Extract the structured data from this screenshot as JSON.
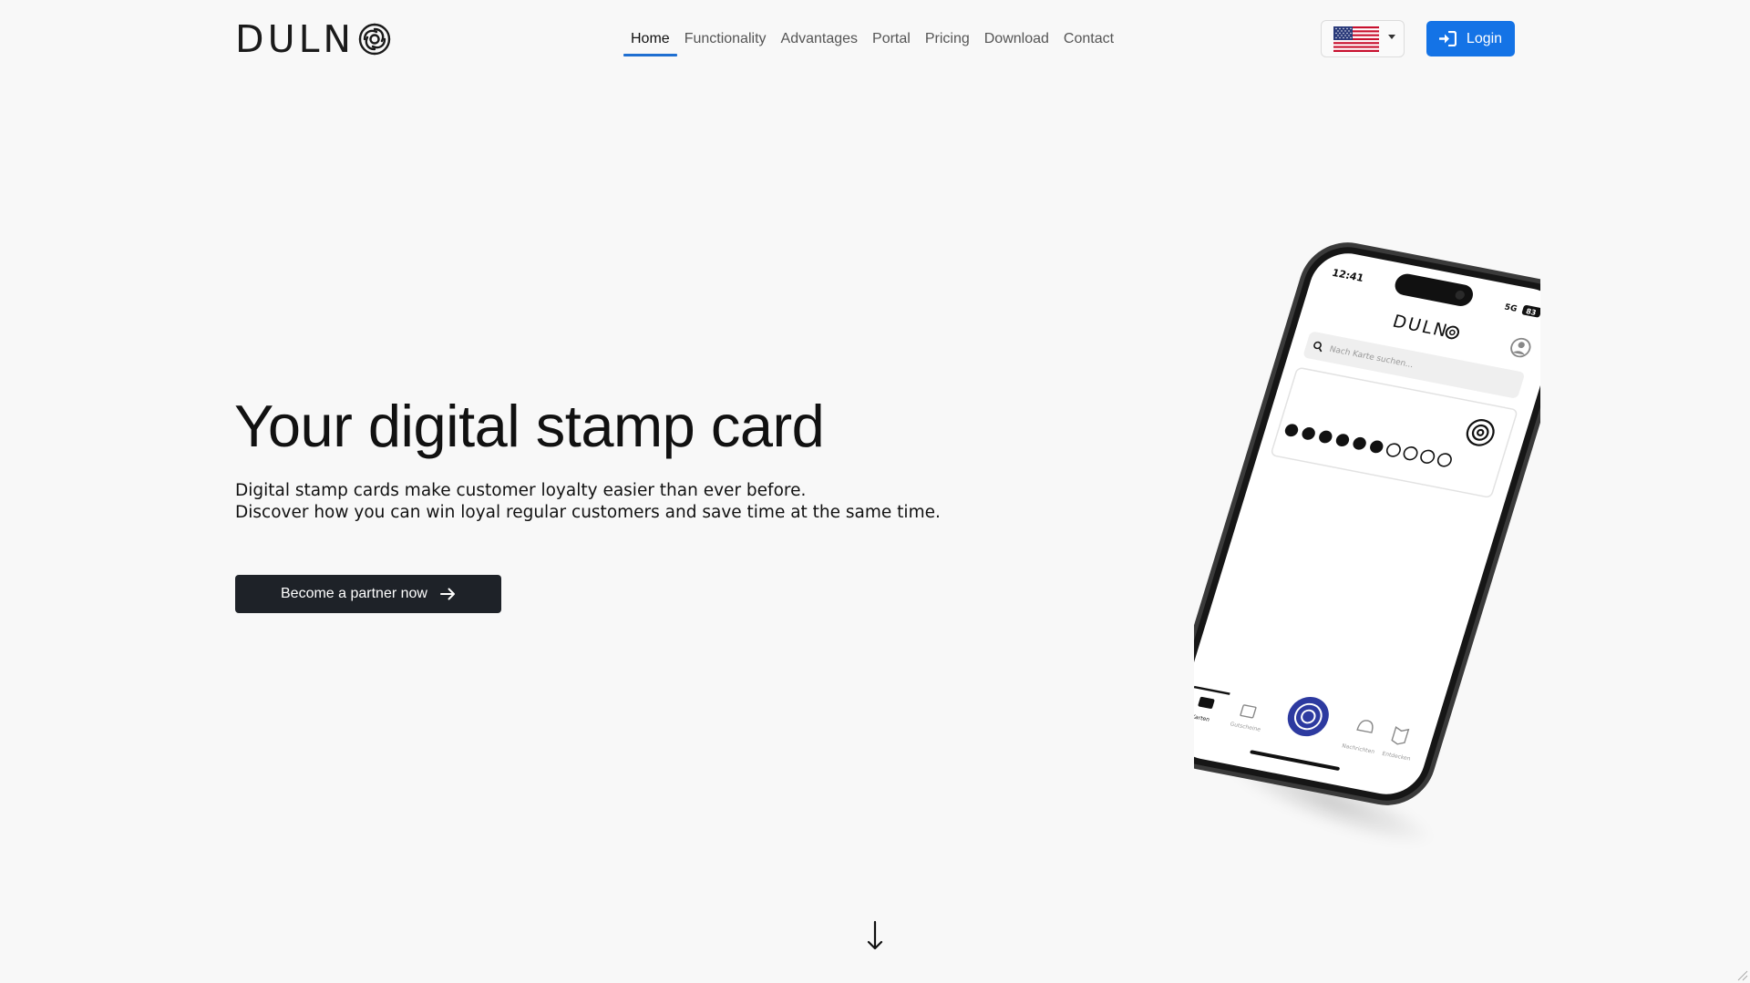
{
  "header": {
    "logo_text": "DULN",
    "nav": [
      {
        "label": "Home",
        "active": true
      },
      {
        "label": "Functionality"
      },
      {
        "label": "Advantages"
      },
      {
        "label": "Portal"
      },
      {
        "label": "Pricing"
      },
      {
        "label": "Download"
      },
      {
        "label": "Contact"
      }
    ],
    "language_icon": "us-flag-icon",
    "login_label": "Login",
    "accent_color": "#1473e6"
  },
  "hero": {
    "title": "Your digital stamp card",
    "subtitle_line1": "Digital stamp cards make customer loyalty easier than ever before.",
    "subtitle_line2": "Discover how you can win loyal regular customers and save time at the same time.",
    "cta_label": "Become a partner now"
  },
  "phone": {
    "time": "12:41",
    "network": "5G",
    "battery": "83",
    "app_logo": "DULN",
    "search_placeholder": "Nach Karte suchen...",
    "stamps_filled": 6,
    "stamps_total": 10,
    "tabs": [
      "Karten",
      "Gutscheine",
      "Nachrichten",
      "Entdecken"
    ]
  }
}
